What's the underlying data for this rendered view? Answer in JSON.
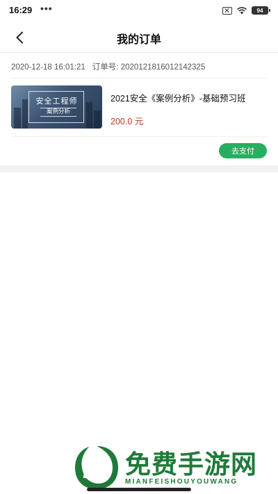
{
  "status_bar": {
    "time": "16:29",
    "dots": "•••",
    "battery": "94"
  },
  "nav": {
    "title": "我的订单"
  },
  "order": {
    "datetime": "2020-12-18 16:01:21",
    "number_label": "订单号:",
    "number": "2020121816012142325",
    "product": {
      "name": "2021安全《案例分析》-基础预习班",
      "price": "200.0 元",
      "image_title": "安全工程师",
      "image_subtitle": "案例分析"
    },
    "pay_label": "去支付"
  },
  "watermark": {
    "title": "免费手游网",
    "subtitle": "MIANFEISHOUYOUWANG"
  }
}
